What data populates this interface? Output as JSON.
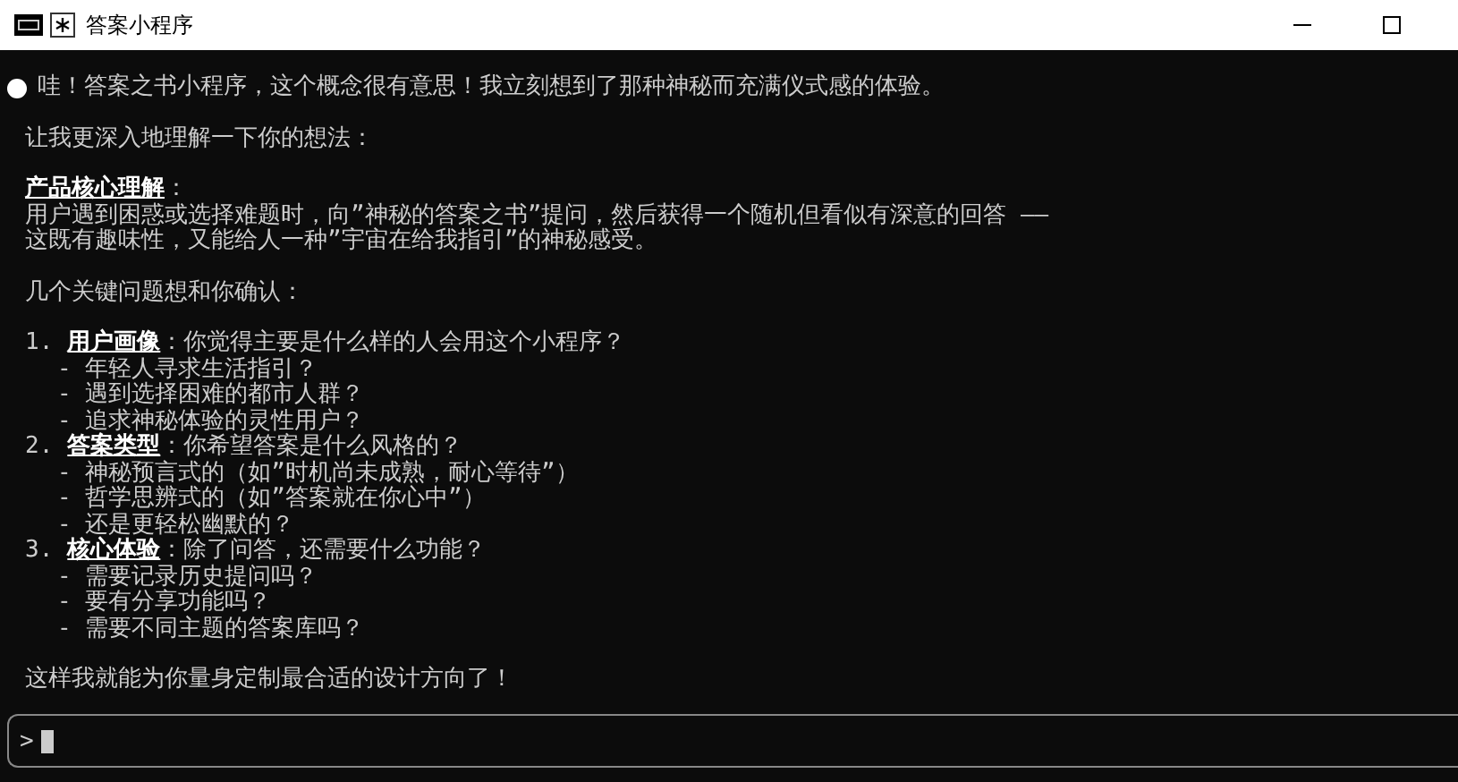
{
  "window": {
    "title": "答案小程序"
  },
  "message": {
    "intro": "哇！答案之书小程序，这个概念很有意思！我立刻想到了那种神秘而充满仪式感的体验。",
    "paragraphs": [
      {
        "lines": [
          "让我更深入地理解一下你的想法："
        ]
      },
      {
        "lines": [
          "**产品核心理解**：",
          "用户遇到困惑或选择难题时，向”神秘的答案之书”提问，然后获得一个随机但看似有深意的回答 ——",
          "这既有趣味性，又能给人一种”宇宙在给我指引”的神秘感受。"
        ]
      },
      {
        "lines": [
          "几个关键问题想和你确认："
        ]
      }
    ],
    "questions": [
      {
        "number": "1.",
        "text": "**用户画像**：你觉得主要是什么样的人会用这个小程序？",
        "children": [
          "- 年轻人寻求生活指引？",
          "- 遇到选择困难的都市人群？",
          "- 追求神秘体验的灵性用户？"
        ]
      },
      {
        "number": "2.",
        "text": "**答案类型**：你希望答案是什么风格的？",
        "children": [
          "- 神秘预言式的（如”时机尚未成熟，耐心等待”）",
          "- 哲学思辨式的（如”答案就在你心中”）",
          "- 还是更轻松幽默的？"
        ]
      },
      {
        "number": "3.",
        "text": "**核心体验**：除了问答，还需要什么功能？",
        "children": [
          "- 需要记录历史提问吗？",
          "- 要有分享功能吗？",
          "- 需要不同主题的答案库吗？"
        ]
      }
    ],
    "closing": "这样我就能为你量身定制最合适的设计方向了！"
  },
  "prompt": {
    "symbol": ">"
  }
}
